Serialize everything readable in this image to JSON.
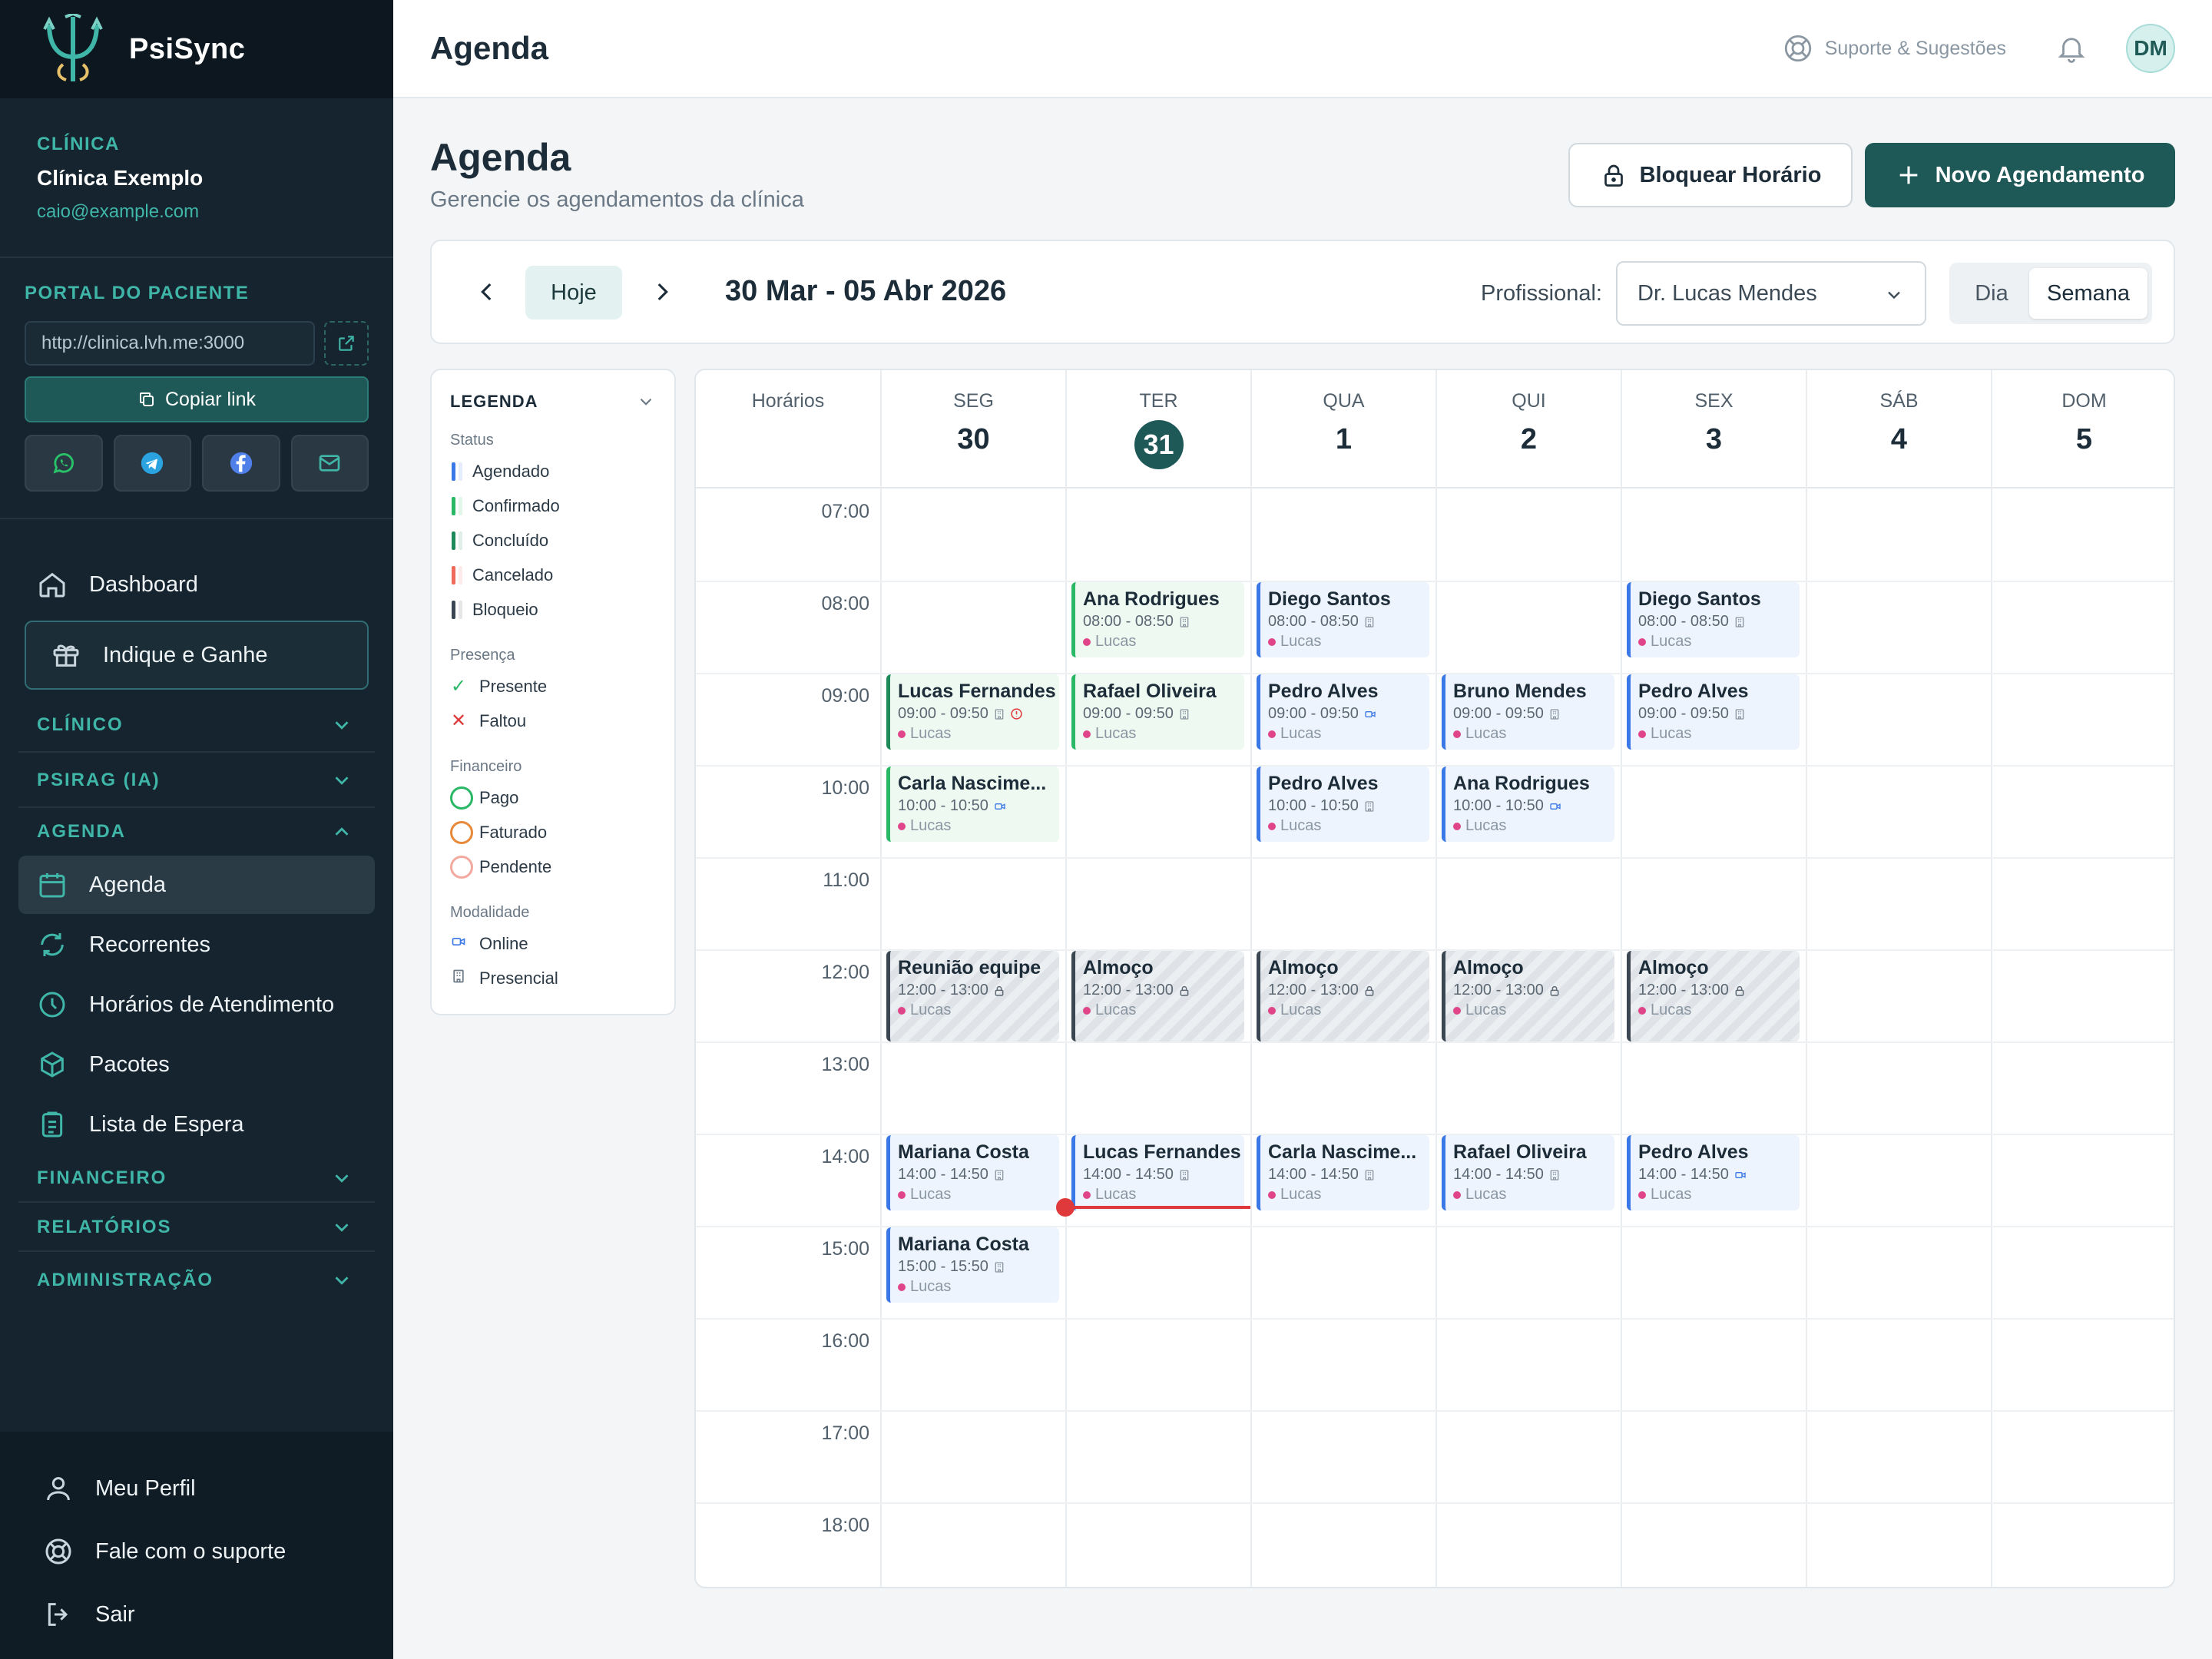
{
  "app": {
    "brand": "PsiSync"
  },
  "clinic": {
    "caption": "CLÍNICA",
    "name": "Clínica Exemplo",
    "email": "caio@example.com"
  },
  "portal": {
    "caption": "PORTAL DO PACIENTE",
    "url": "http://clinica.lvh.me:3000",
    "copy_label": "Copiar link",
    "share": [
      "whatsapp-icon",
      "telegram-icon",
      "facebook-icon",
      "mail-icon"
    ]
  },
  "nav": {
    "dashboard": "Dashboard",
    "invite": "Indique e Ganhe",
    "sections": {
      "clinico": "CLÍNICO",
      "psirag": "PSIRAG (IA)",
      "agenda": "AGENDA",
      "financeiro": "FINANCEIRO",
      "relatorios": "RELATÓRIOS",
      "administracao": "ADMINISTRAÇÃO"
    },
    "agenda_items": [
      "Agenda",
      "Recorrentes",
      "Horários de Atendimento",
      "Pacotes",
      "Lista de Espera"
    ],
    "bottom": [
      "Meu Perfil",
      "Fale com o suporte",
      "Sair"
    ]
  },
  "topbar": {
    "title": "Agenda",
    "support": "Suporte & Sugestões",
    "avatar": "DM"
  },
  "page": {
    "title": "Agenda",
    "subtitle": "Gerencie os agendamentos da clínica",
    "block_button": "Bloquear Horário",
    "new_button": "Novo Agendamento"
  },
  "toolbar": {
    "today": "Hoje",
    "range": "30 Mar - 05 Abr 2026",
    "professional_label": "Profissional:",
    "professional_value": "Dr. Lucas Mendes",
    "view_day": "Dia",
    "view_week": "Semana",
    "selected_view": "Semana"
  },
  "legend": {
    "title": "LEGENDA",
    "status_caption": "Status",
    "status": [
      {
        "label": "Agendado",
        "color": "#3b78e7"
      },
      {
        "label": "Confirmado",
        "color": "#29b865"
      },
      {
        "label": "Concluído",
        "color": "#1e8a5a"
      },
      {
        "label": "Cancelado",
        "color": "#ef6a5a"
      },
      {
        "label": "Bloqueio",
        "color": "#3a4752"
      }
    ],
    "presence_caption": "Presença",
    "presence": [
      {
        "label": "Presente",
        "symbol": "✓",
        "color": "#29b865"
      },
      {
        "label": "Faltou",
        "symbol": "✕",
        "color": "#e0393b"
      }
    ],
    "finance_caption": "Financeiro",
    "finance": [
      {
        "label": "Pago",
        "color": "#29b865"
      },
      {
        "label": "Faturado",
        "color": "#e8893a"
      },
      {
        "label": "Pendente",
        "color": "#f2a9a0"
      }
    ],
    "modality_caption": "Modalidade",
    "modality": [
      {
        "label": "Online",
        "icon": "video-icon"
      },
      {
        "label": "Presencial",
        "icon": "building-icon"
      }
    ]
  },
  "calendar": {
    "hours_header": "Horários",
    "days": [
      {
        "dow": "SEG",
        "num": "30",
        "today": false
      },
      {
        "dow": "TER",
        "num": "31",
        "today": true
      },
      {
        "dow": "QUA",
        "num": "1",
        "today": false
      },
      {
        "dow": "QUI",
        "num": "2",
        "today": false
      },
      {
        "dow": "SEX",
        "num": "3",
        "today": false
      },
      {
        "dow": "SÁB",
        "num": "4",
        "today": false
      },
      {
        "dow": "DOM",
        "num": "5",
        "today": false
      }
    ],
    "hours": [
      "07:00",
      "08:00",
      "09:00",
      "10:00",
      "11:00",
      "12:00",
      "13:00",
      "14:00",
      "15:00",
      "16:00",
      "17:00",
      "18:00"
    ],
    "now_time": "15:25",
    "events": [
      {
        "day": 1,
        "start": "08:00",
        "name": "Ana Rodrigues",
        "time": "08:00 - 08:50",
        "mode": "presencial",
        "status": "confirmado",
        "prof": "Lucas"
      },
      {
        "day": 2,
        "start": "08:00",
        "name": "Diego Santos",
        "time": "08:00 - 08:50",
        "mode": "presencial",
        "status": "agendado",
        "prof": "Lucas"
      },
      {
        "day": 4,
        "start": "08:00",
        "name": "Diego Santos",
        "time": "08:00 - 08:50",
        "mode": "presencial",
        "status": "agendado",
        "prof": "Lucas"
      },
      {
        "day": 0,
        "start": "09:00",
        "name": "Lucas Fernandes",
        "time": "09:00 - 09:50",
        "mode": "presencial",
        "status": "concluido",
        "prof": "Lucas",
        "alert": true
      },
      {
        "day": 1,
        "start": "09:00",
        "name": "Rafael Oliveira",
        "time": "09:00 - 09:50",
        "mode": "presencial",
        "status": "confirmado",
        "prof": "Lucas"
      },
      {
        "day": 2,
        "start": "09:00",
        "name": "Pedro Alves",
        "time": "09:00 - 09:50",
        "mode": "online",
        "status": "agendado",
        "prof": "Lucas"
      },
      {
        "day": 3,
        "start": "09:00",
        "name": "Bruno Mendes",
        "time": "09:00 - 09:50",
        "mode": "presencial",
        "status": "agendado",
        "prof": "Lucas"
      },
      {
        "day": 4,
        "start": "09:00",
        "name": "Pedro Alves",
        "time": "09:00 - 09:50",
        "mode": "presencial",
        "status": "agendado",
        "prof": "Lucas"
      },
      {
        "day": 0,
        "start": "10:00",
        "name": "Carla Nascime...",
        "time": "10:00 - 10:50",
        "mode": "online",
        "status": "confirmado",
        "prof": "Lucas"
      },
      {
        "day": 2,
        "start": "10:00",
        "name": "Pedro Alves",
        "time": "10:00 - 10:50",
        "mode": "presencial",
        "status": "agendado",
        "prof": "Lucas"
      },
      {
        "day": 3,
        "start": "10:00",
        "name": "Ana Rodrigues",
        "time": "10:00 - 10:50",
        "mode": "online",
        "status": "agendado",
        "prof": "Lucas"
      },
      {
        "day": 0,
        "start": "12:00",
        "name": "Reunião equipe",
        "time": "12:00 - 13:00",
        "mode": "lock",
        "status": "bloqueio",
        "prof": "Lucas"
      },
      {
        "day": 1,
        "start": "12:00",
        "name": "Almoço",
        "time": "12:00 - 13:00",
        "mode": "lock",
        "status": "bloqueio",
        "prof": "Lucas"
      },
      {
        "day": 2,
        "start": "12:00",
        "name": "Almoço",
        "time": "12:00 - 13:00",
        "mode": "lock",
        "status": "bloqueio",
        "prof": "Lucas"
      },
      {
        "day": 3,
        "start": "12:00",
        "name": "Almoço",
        "time": "12:00 - 13:00",
        "mode": "lock",
        "status": "bloqueio",
        "prof": "Lucas"
      },
      {
        "day": 4,
        "start": "12:00",
        "name": "Almoço",
        "time": "12:00 - 13:00",
        "mode": "lock",
        "status": "bloqueio",
        "prof": "Lucas"
      },
      {
        "day": 0,
        "start": "14:00",
        "name": "Mariana Costa",
        "time": "14:00 - 14:50",
        "mode": "presencial",
        "status": "agendado",
        "prof": "Lucas"
      },
      {
        "day": 1,
        "start": "14:00",
        "name": "Lucas Fernandes",
        "time": "14:00 - 14:50",
        "mode": "presencial",
        "status": "agendado",
        "prof": "Lucas"
      },
      {
        "day": 2,
        "start": "14:00",
        "name": "Carla Nascime...",
        "time": "14:00 - 14:50",
        "mode": "presencial",
        "status": "agendado",
        "prof": "Lucas"
      },
      {
        "day": 3,
        "start": "14:00",
        "name": "Rafael Oliveira",
        "time": "14:00 - 14:50",
        "mode": "presencial",
        "status": "agendado",
        "prof": "Lucas"
      },
      {
        "day": 4,
        "start": "14:00",
        "name": "Pedro Alves",
        "time": "14:00 - 14:50",
        "mode": "online",
        "status": "agendado",
        "prof": "Lucas"
      },
      {
        "day": 0,
        "start": "15:00",
        "name": "Mariana Costa",
        "time": "15:00 - 15:50",
        "mode": "presencial",
        "status": "agendado",
        "prof": "Lucas"
      }
    ]
  }
}
